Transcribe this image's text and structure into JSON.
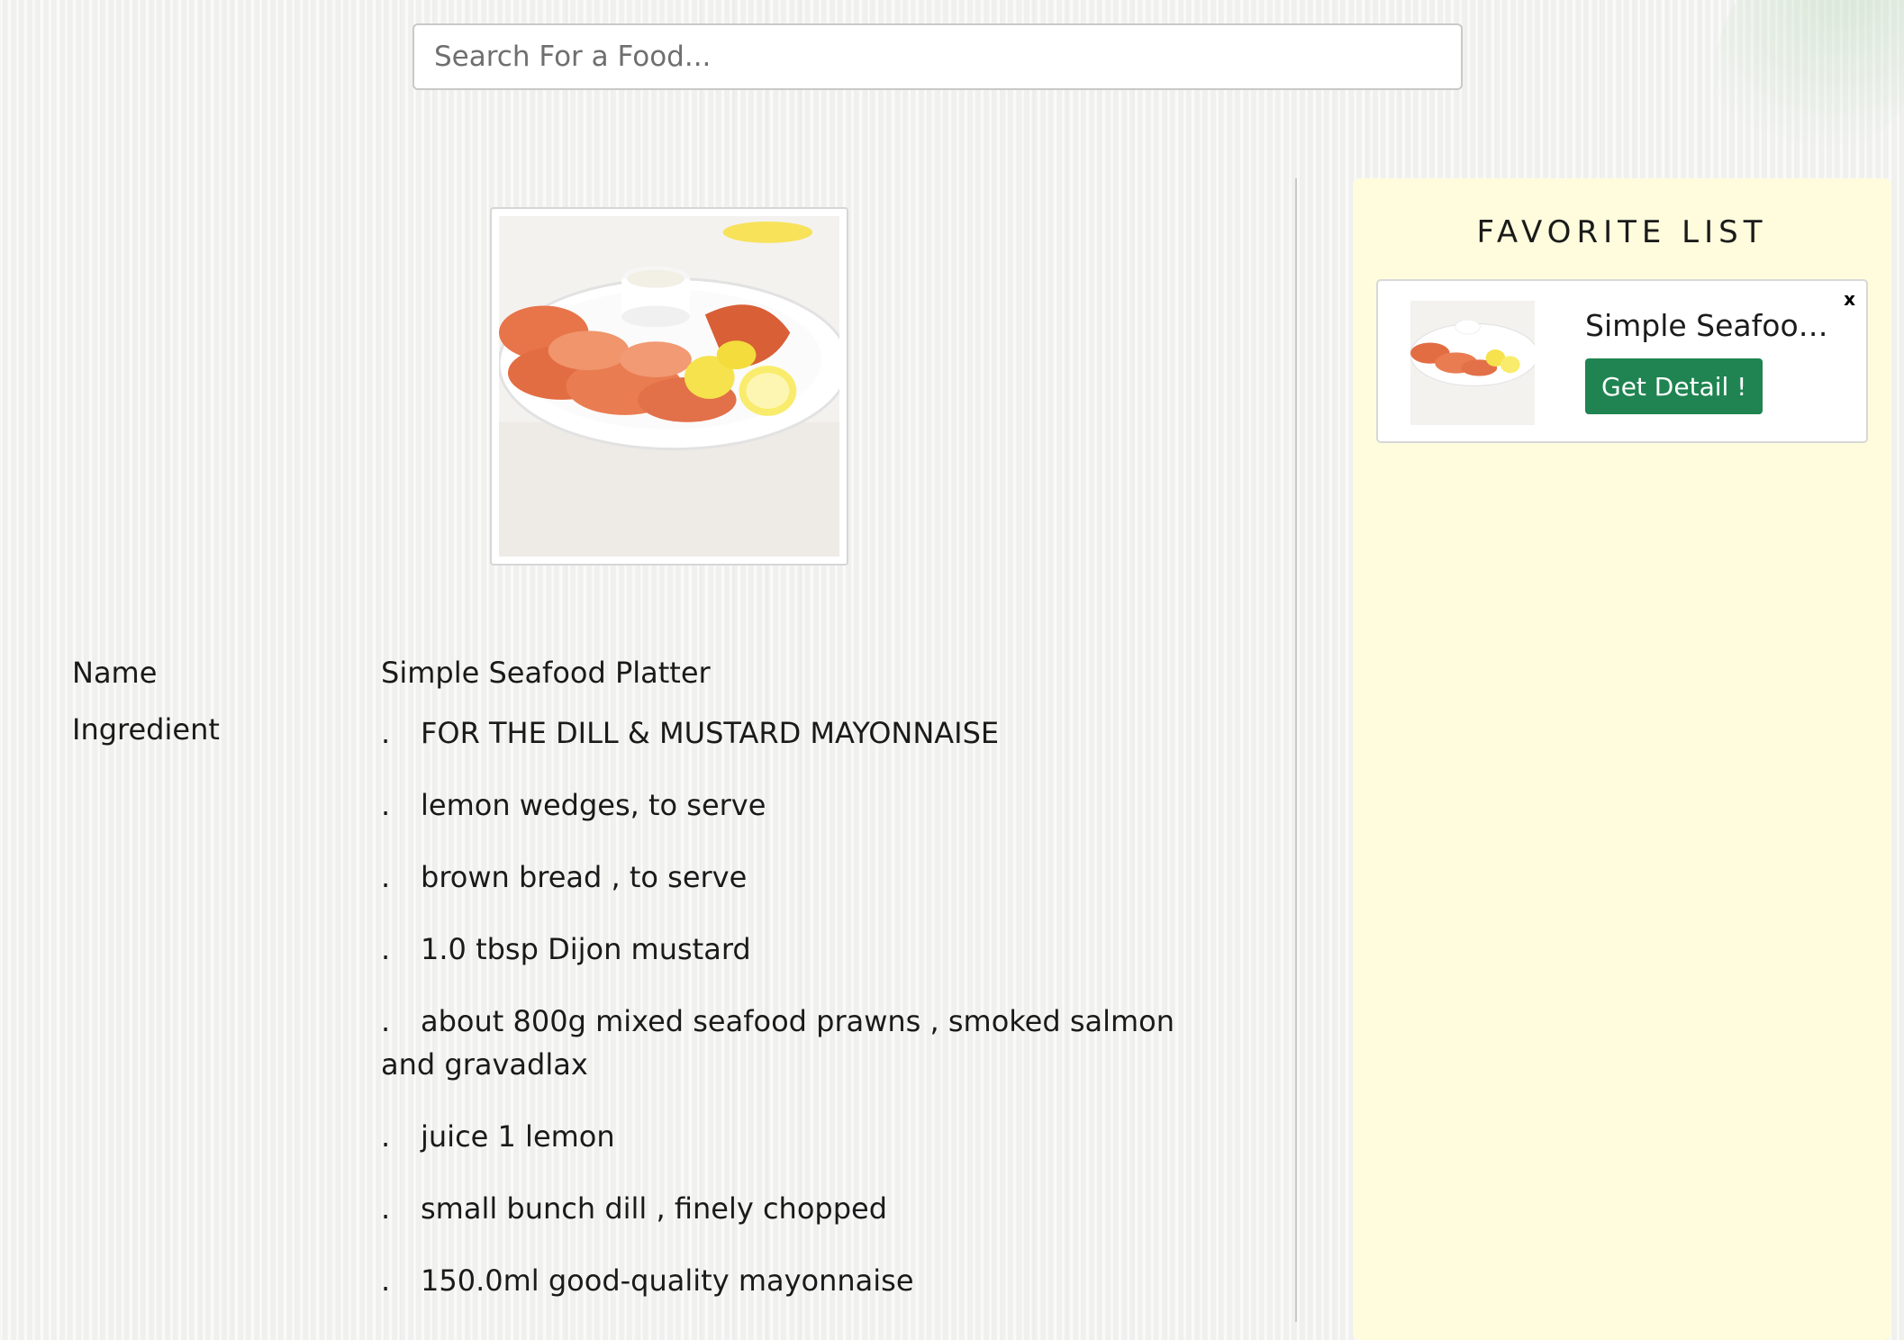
{
  "search": {
    "placeholder": "Search For a Food..."
  },
  "recipe": {
    "image_alt": "Simple Seafood Platter",
    "name_label": "Name",
    "name": "Simple Seafood Platter",
    "ingredient_label": "Ingredient",
    "bullet": ".",
    "ingredients": [
      "FOR THE DILL & MUSTARD MAYONNAISE",
      "lemon wedges, to serve",
      "brown bread , to serve",
      "1.0 tbsp Dijon mustard",
      "about 800g mixed seafood prawns , smoked salmon and gravadlax",
      "juice 1 lemon",
      "small bunch dill , finely chopped",
      "150.0ml good-quality mayonnaise"
    ]
  },
  "favorites": {
    "title": "FAVORITE LIST",
    "items": [
      {
        "name": "Simple Seafood P...",
        "button": "Get Detail !",
        "close": "x"
      }
    ]
  },
  "colors": {
    "accent_button": "#1f8451",
    "favorite_panel_bg": "#fefcdd"
  }
}
